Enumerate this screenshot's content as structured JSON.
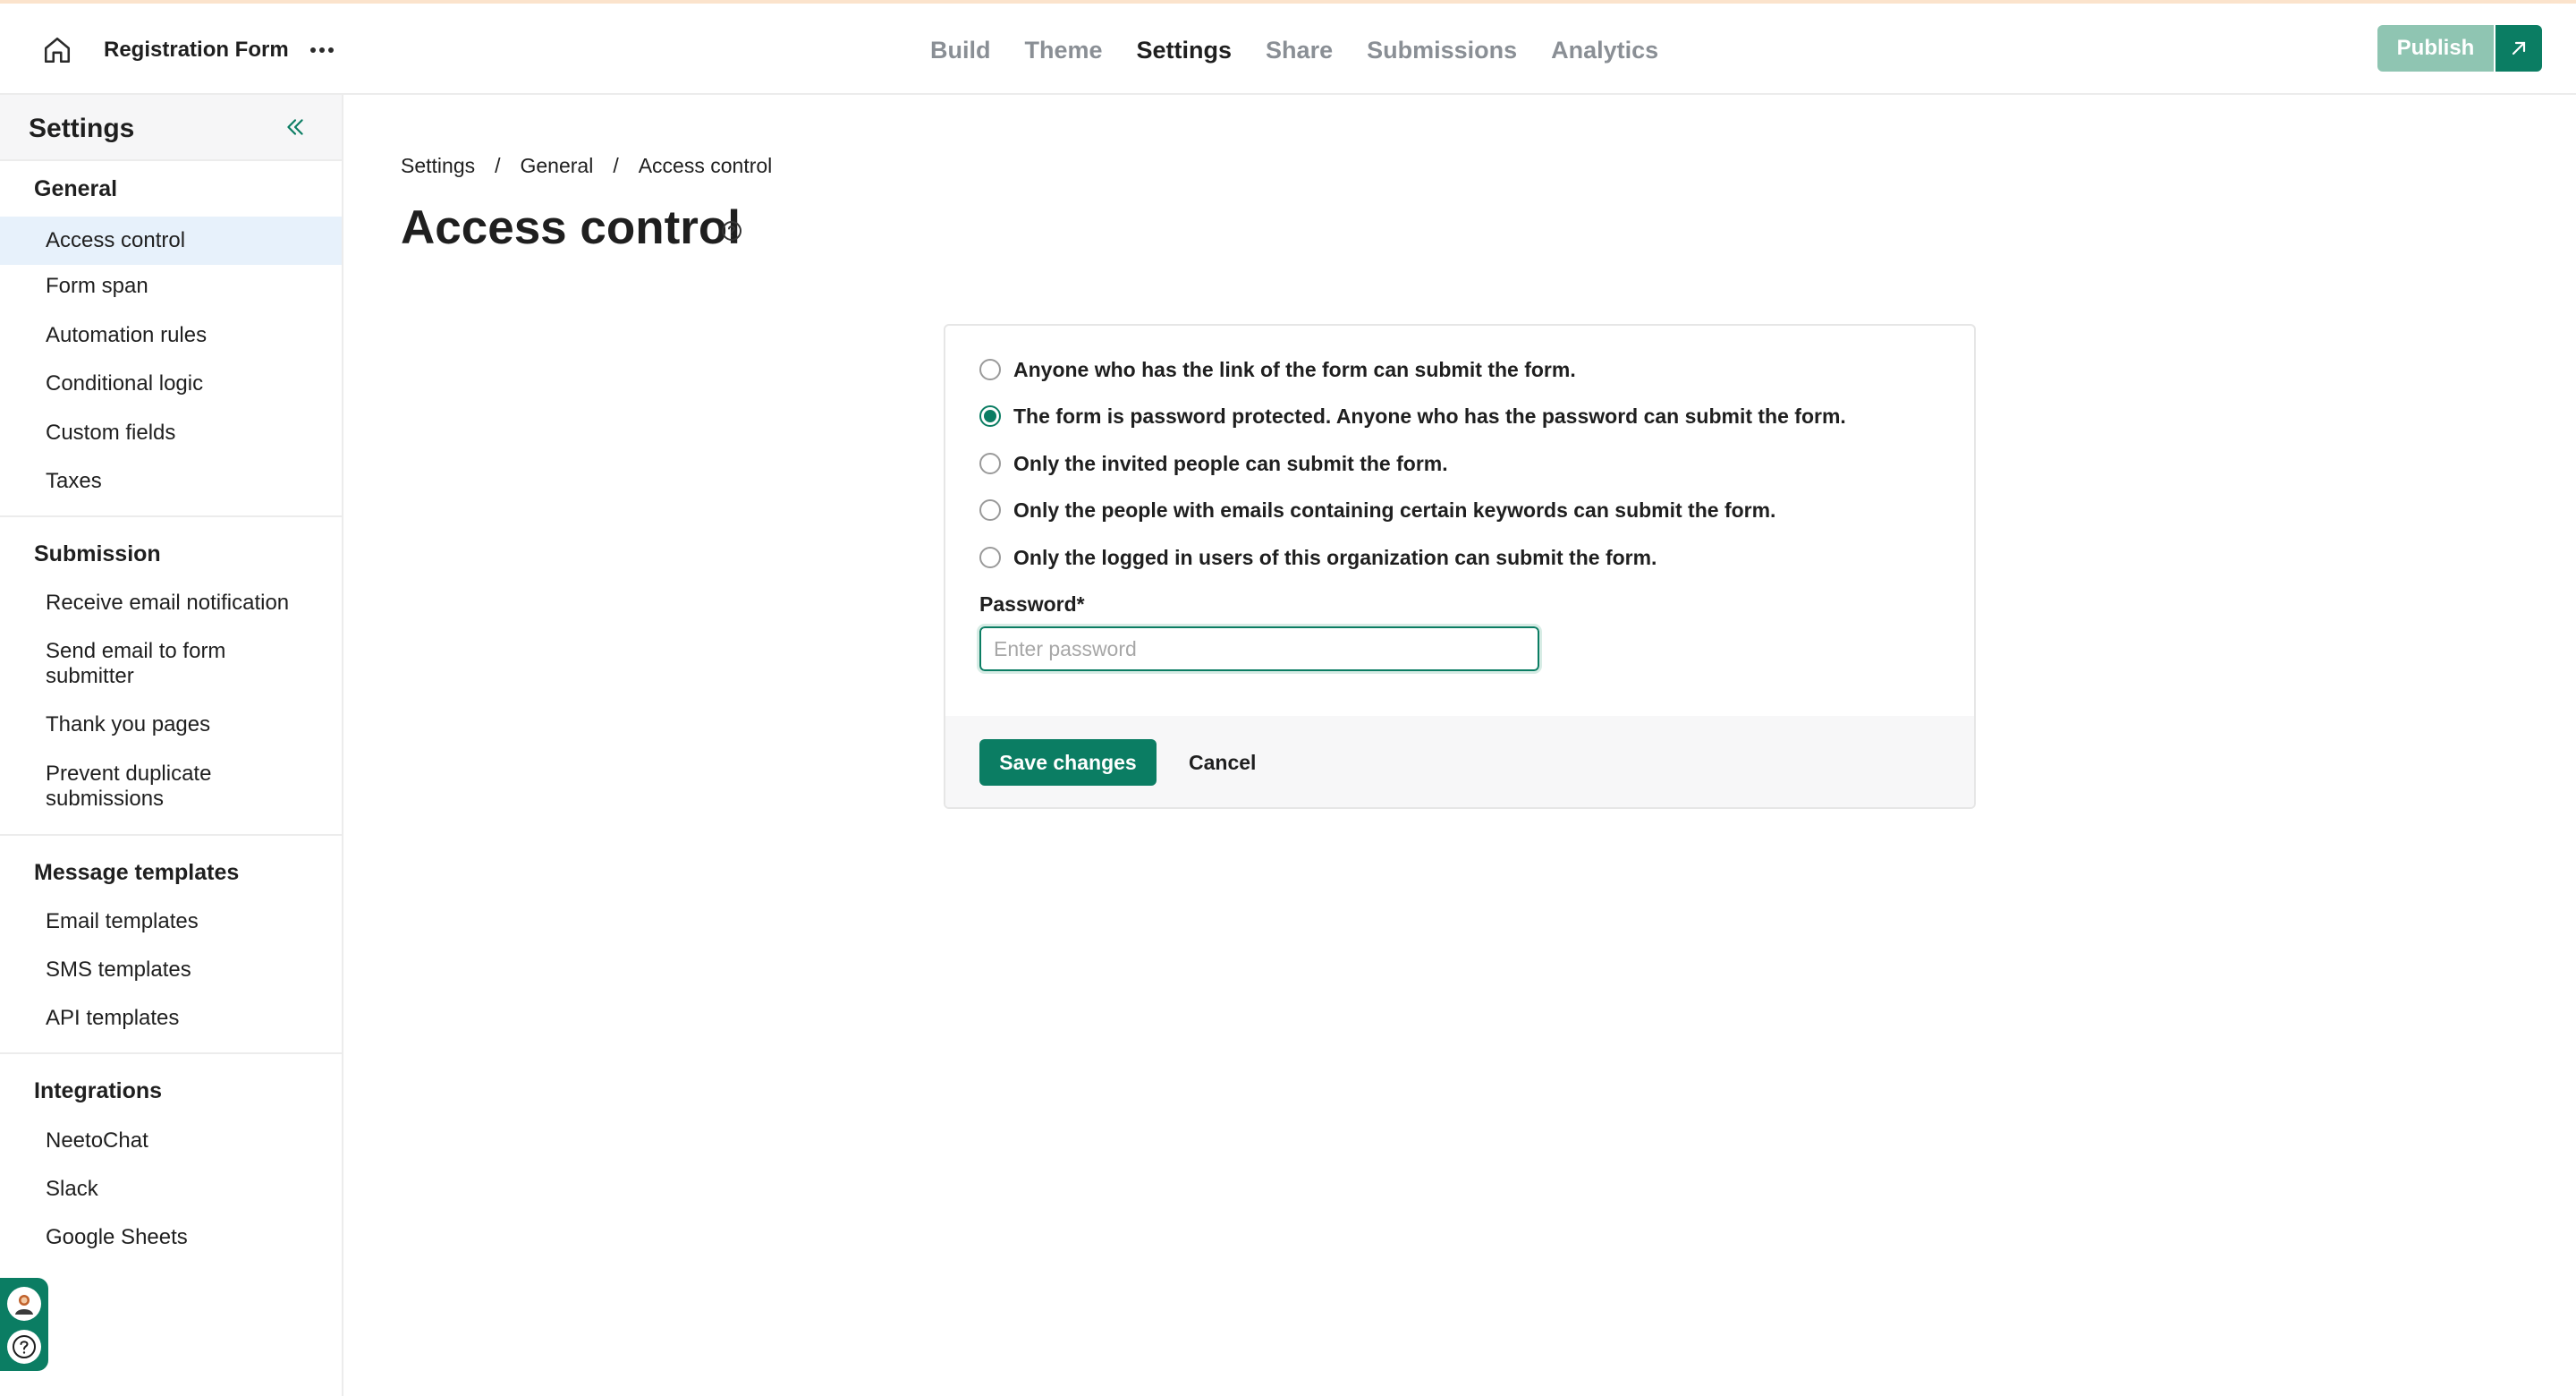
{
  "header": {
    "form_title": "Registration Form",
    "nav": [
      "Build",
      "Theme",
      "Settings",
      "Share",
      "Submissions",
      "Analytics"
    ],
    "active_nav": "Settings",
    "publish_label": "Publish"
  },
  "sidebar": {
    "title": "Settings",
    "sections": [
      {
        "title": "General",
        "items": [
          "Access control",
          "Form span",
          "Automation rules",
          "Conditional logic",
          "Custom fields",
          "Taxes"
        ]
      },
      {
        "title": "Submission",
        "items": [
          "Receive email notification",
          "Send email to form submitter",
          "Thank you pages",
          "Prevent duplicate submissions"
        ]
      },
      {
        "title": "Message templates",
        "items": [
          "Email templates",
          "SMS templates",
          "API templates"
        ]
      },
      {
        "title": "Integrations",
        "items": [
          "NeetoChat",
          "Slack",
          "Google Sheets"
        ]
      }
    ],
    "active_item": "Access control"
  },
  "breadcrumb": [
    "Settings",
    "General",
    "Access control"
  ],
  "page": {
    "title": "Access control"
  },
  "access": {
    "options": [
      "Anyone who has the link of the form can submit the form.",
      "The form is password protected. Anyone who has the password can submit the form.",
      "Only the invited people can submit the form.",
      "Only the people with emails containing certain keywords can submit the form.",
      "Only the logged in users of this organization can submit the form."
    ],
    "selected_index": 1,
    "password_label": "Password*",
    "password_placeholder": "Enter password",
    "password_value": ""
  },
  "actions": {
    "save_label": "Save changes",
    "cancel_label": "Cancel"
  },
  "colors": {
    "accent": "#0b7d63",
    "publish_disabled": "#8fc5b2",
    "active_item_bg": "#e7f1fb"
  }
}
